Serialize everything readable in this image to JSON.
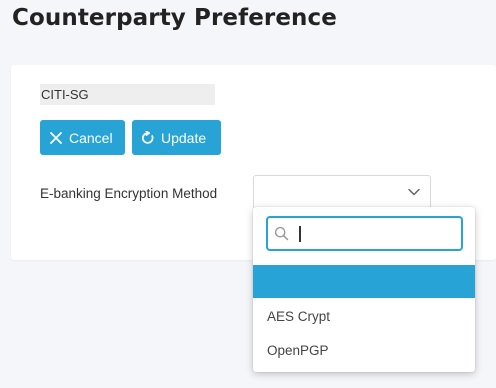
{
  "page": {
    "title": "Counterparty Preference"
  },
  "counterparty": {
    "name": "CITI-SG"
  },
  "actions": {
    "cancel_label": "Cancel",
    "update_label": "Update"
  },
  "form": {
    "encryption_label": "E-banking Encryption Method",
    "encryption_value": ""
  },
  "dropdown": {
    "search_value": "",
    "options": [
      "",
      "AES Crypt",
      "OpenPGP"
    ],
    "selected_index": 0
  },
  "colors": {
    "accent": "#27a3d6",
    "background": "#f4f6f9"
  },
  "icons": {
    "cancel": "close-icon",
    "update": "refresh-icon",
    "select": "chevron-down-icon",
    "search": "search-icon"
  }
}
